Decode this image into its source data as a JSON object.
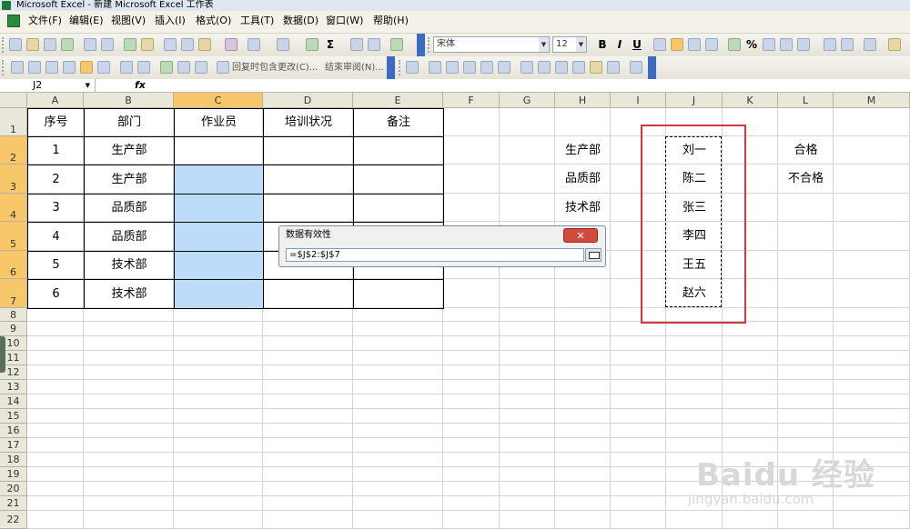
{
  "window": {
    "title": "Microsoft Excel - 新建 Microsoft Excel 工作表"
  },
  "menu": [
    "文件(F)",
    "编辑(E)",
    "视图(V)",
    "插入(I)",
    "格式(O)",
    "工具(T)",
    "数据(D)",
    "窗口(W)",
    "帮助(H)"
  ],
  "toolbar": {
    "font_name": "宋体",
    "font_size": "12",
    "bold": "B",
    "italic": "I",
    "underline": "U",
    "review_text": "回复时包含更改(C)...",
    "end_review": "结束审阅(N)..."
  },
  "formula_bar": {
    "name_box": "J2",
    "fx": "fx"
  },
  "columns": [
    "A",
    "B",
    "C",
    "D",
    "E",
    "F",
    "G",
    "H",
    "I",
    "J",
    "K",
    "L",
    "M"
  ],
  "rows": [
    "1",
    "2",
    "3",
    "4",
    "5",
    "6",
    "7",
    "8",
    "9",
    "10",
    "11",
    "12",
    "13",
    "14",
    "15",
    "16",
    "17",
    "18",
    "19",
    "20",
    "21",
    "22"
  ],
  "table": {
    "headers": [
      "序号",
      "部门",
      "作业员",
      "培训状况",
      "备注"
    ],
    "rows": [
      [
        "1",
        "生产部"
      ],
      [
        "2",
        "生产部"
      ],
      [
        "3",
        "品质部"
      ],
      [
        "4",
        "品质部"
      ],
      [
        "5",
        "技术部"
      ],
      [
        "6",
        "技术部"
      ]
    ]
  },
  "lists": {
    "departments": [
      "生产部",
      "品质部",
      "技术部"
    ],
    "names": [
      "刘一",
      "陈二",
      "张三",
      "李四",
      "王五",
      "赵六"
    ],
    "status": [
      "合格",
      "不合格"
    ]
  },
  "dialog": {
    "title": "数据有效性",
    "reference": "=$J$2:$J$7",
    "close": "✕"
  },
  "watermark": {
    "main": "Baidu 经验",
    "sub": "jingyan.baidu.com"
  },
  "colors": {
    "selection": "#bcdcf9",
    "highlight_box": "#d2363f",
    "header_selected": "#f7c769"
  }
}
